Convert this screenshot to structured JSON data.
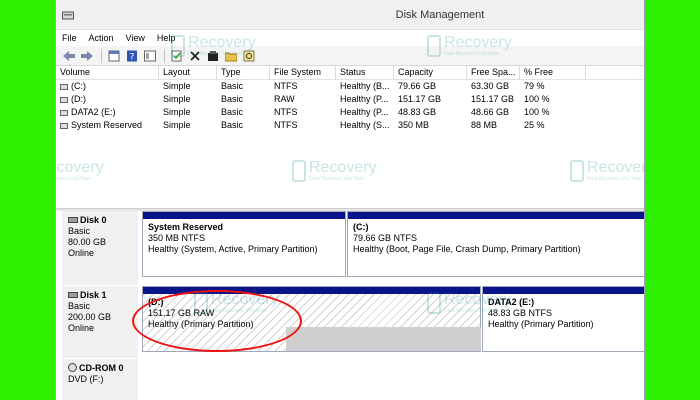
{
  "window": {
    "title": "Disk Management"
  },
  "menu": {
    "items": [
      "File",
      "Action",
      "View",
      "Help"
    ]
  },
  "toolbar": {
    "icons": [
      "back-icon",
      "forward-icon",
      "properties-icon",
      "help-icon",
      "console-icon",
      "check-icon",
      "delete-icon",
      "open-icon",
      "explore-icon",
      "refresh-icon"
    ]
  },
  "volumes": {
    "headers": [
      "Volume",
      "Layout",
      "Type",
      "File System",
      "Status",
      "Capacity",
      "Free Spa...",
      "% Free"
    ],
    "rows": [
      [
        "(C:)",
        "Simple",
        "Basic",
        "NTFS",
        "Healthy (B...",
        "79.66 GB",
        "63.30 GB",
        "79 %"
      ],
      [
        "(D:)",
        "Simple",
        "Basic",
        "RAW",
        "Healthy (P...",
        "151.17 GB",
        "151.17 GB",
        "100 %"
      ],
      [
        "DATA2 (E:)",
        "Simple",
        "Basic",
        "NTFS",
        "Healthy (P...",
        "48.83 GB",
        "48.66 GB",
        "100 %"
      ],
      [
        "System Reserved",
        "Simple",
        "Basic",
        "NTFS",
        "Healthy (S...",
        "350 MB",
        "88 MB",
        "25 %"
      ]
    ]
  },
  "disks": {
    "disk0": {
      "name": "Disk 0",
      "type": "Basic",
      "size": "80.00 GB",
      "state": "Online",
      "partitions": [
        {
          "name": "System Reserved",
          "size": "350 MB NTFS",
          "status": "Healthy (System, Active, Primary Partition)"
        },
        {
          "name": "(C:)",
          "size": "79.66 GB NTFS",
          "status": "Healthy (Boot, Page File, Crash Dump, Primary Partition)"
        }
      ]
    },
    "disk1": {
      "name": "Disk 1",
      "type": "Basic",
      "size": "200.00 GB",
      "state": "Online",
      "partitions": [
        {
          "name": "(D:)",
          "size": "151.17 GB RAW",
          "status": "Healthy (Primary Partition)"
        },
        {
          "name": "DATA2  (E:)",
          "size": "48.83 GB NTFS",
          "status": "Healthy (Primary Partition)"
        }
      ]
    },
    "cdrom0": {
      "name": "CD-ROM 0",
      "type": "DVD (F:)"
    }
  },
  "watermark": {
    "brand": "Recovery",
    "tagline": "Data Recovery Viet Nam"
  },
  "colors": {
    "background": "#2cf000",
    "partition_stripe": "#0a148a",
    "highlight": "#ee1111"
  }
}
